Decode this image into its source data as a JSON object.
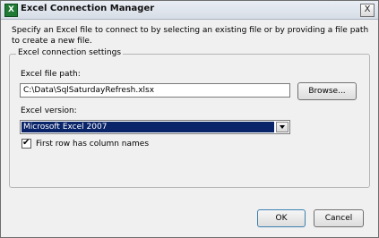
{
  "window": {
    "title": "Excel Connection Manager",
    "close_symbol": "X",
    "app_icon_letter": "X"
  },
  "description": "Specify an Excel file to connect to by selecting an existing file or by providing a file path to create a new file.",
  "group": {
    "legend": "Excel connection settings",
    "file_path_label": "Excel file path:",
    "file_path_value": "C:\\Data\\SqlSaturdayRefresh.xlsx",
    "browse_label": "Browse...",
    "version_label": "Excel version:",
    "version_selected": "Microsoft Excel 2007",
    "first_row_checked": true,
    "first_row_label": "First row has column names"
  },
  "buttons": {
    "ok": "OK",
    "cancel": "Cancel"
  }
}
